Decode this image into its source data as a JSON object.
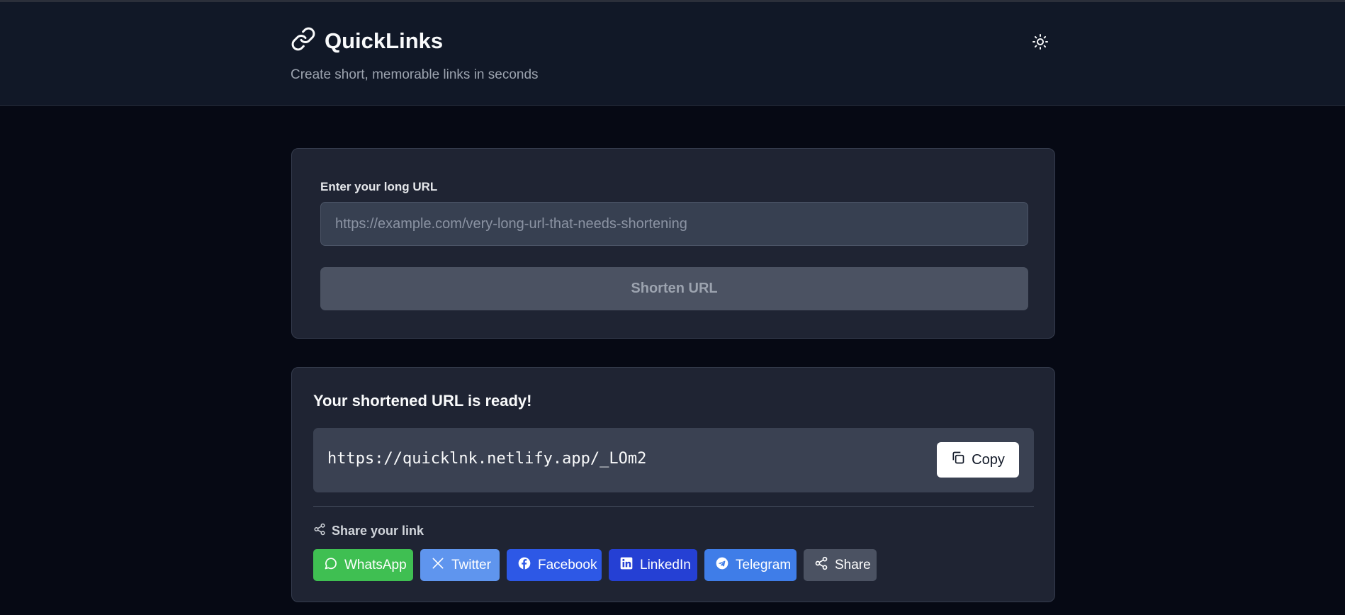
{
  "app": {
    "title": "QuickLinks",
    "subtitle": "Create short, memorable links in seconds",
    "brand_icon": "link-icon",
    "theme_icon": "sun-icon"
  },
  "form": {
    "label": "Enter your long URL",
    "placeholder": "https://example.com/very-long-url-that-needs-shortening",
    "value": "",
    "submit_label": "Shorten URL"
  },
  "result": {
    "title": "Your shortened URL is ready!",
    "short_url": "https://quicklnk.netlify.app/_LOm2",
    "copy_label": "Copy",
    "copy_icon": "copy-icon"
  },
  "share": {
    "heading": "Share your link",
    "heading_icon": "share-icon",
    "buttons": [
      {
        "label": "WhatsApp",
        "icon": "whatsapp-icon",
        "color": "#3fbf52"
      },
      {
        "label": "Twitter",
        "icon": "x-twitter-icon",
        "color": "#5f95ee"
      },
      {
        "label": "Facebook",
        "icon": "facebook-icon",
        "color": "#2d58e6"
      },
      {
        "label": "LinkedIn",
        "icon": "linkedin-icon",
        "color": "#2540d4"
      },
      {
        "label": "Telegram",
        "icon": "telegram-icon",
        "color": "#3f7de8"
      },
      {
        "label": "Share",
        "icon": "share-icon",
        "color": "#4b5262"
      }
    ]
  },
  "colors": {
    "page_bg": "#060914",
    "header_bg": "#111827",
    "card_bg": "#1f2433"
  }
}
